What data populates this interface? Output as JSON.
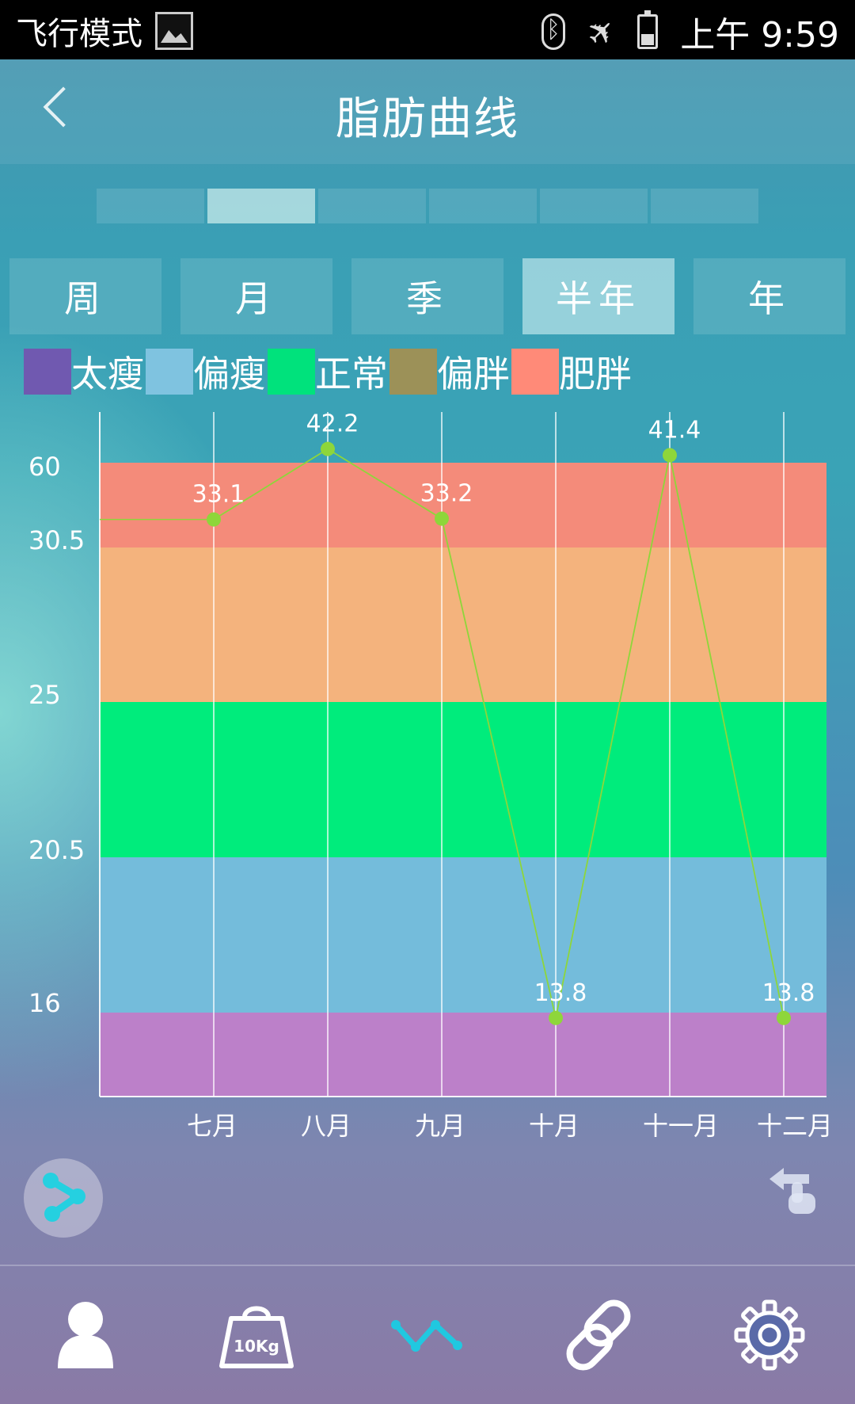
{
  "status_bar": {
    "mode_label": "飞行模式",
    "time": "上午 9:59"
  },
  "header": {
    "title": "脂肪曲线"
  },
  "pager": {
    "count": 6,
    "active_index": 1
  },
  "tabs": [
    {
      "label": "周",
      "active": false
    },
    {
      "label": "月",
      "active": false
    },
    {
      "label": "季",
      "active": false
    },
    {
      "label": "半年",
      "active": true
    },
    {
      "label": "年",
      "active": false
    }
  ],
  "legend": [
    {
      "label": "太瘦",
      "color": "#7059b0"
    },
    {
      "label": "偏瘦",
      "color": "#7fc3e0"
    },
    {
      "label": "正常",
      "color": "#00e27c"
    },
    {
      "label": "偏胖",
      "color": "#9c9158"
    },
    {
      "label": "肥胖",
      "color": "#ff8a78"
    }
  ],
  "chart_data": {
    "type": "line",
    "y_tick_labels": [
      "60",
      "30.5",
      "25",
      "20.5",
      "16"
    ],
    "bands": [
      {
        "from": "30.5",
        "to": "60",
        "color": "#f48b7a"
      },
      {
        "from": "25",
        "to": "30.5",
        "color": "#f4b37d"
      },
      {
        "from": "20.5",
        "to": "25",
        "color": "#00ec7c"
      },
      {
        "from": "16",
        "to": "20.5",
        "color": "#74bcdb"
      },
      {
        "from": "0",
        "to": "16",
        "color": "#bc80c9"
      }
    ],
    "categories": [
      "七月",
      "八月",
      "九月",
      "十月",
      "十一月",
      "十二月"
    ],
    "series": [
      {
        "values": [
          33.1,
          42.2,
          33.2,
          13.8,
          41.4,
          13.8
        ],
        "labels": [
          "33.1",
          "42.2",
          "33.2",
          "13.8",
          "41.4",
          "13.8"
        ],
        "color": "#8ed63a"
      }
    ]
  }
}
